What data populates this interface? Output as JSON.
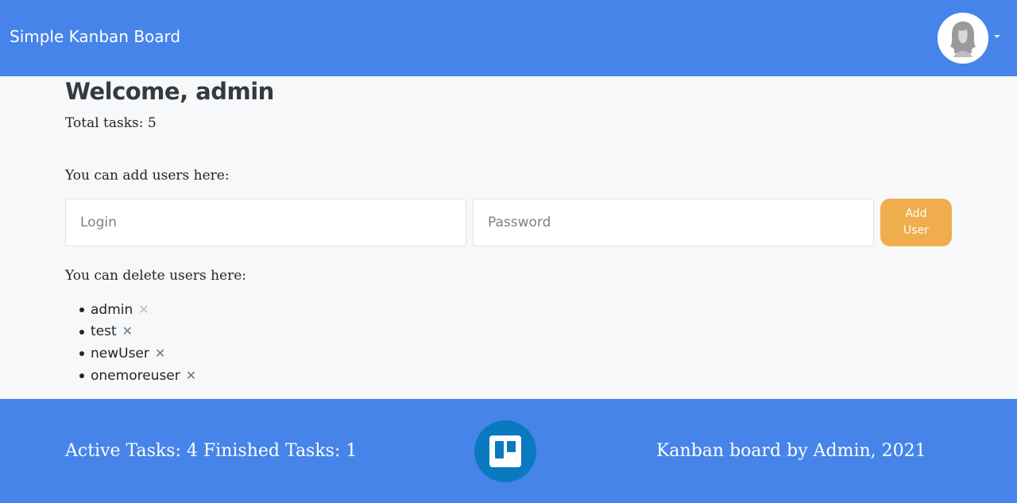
{
  "header": {
    "brand": "Simple Kanban Board",
    "avatar_icon": "user-avatar-icon",
    "menu_icon": "caret-down-icon",
    "color": "#4684ea"
  },
  "main": {
    "welcome": "Welcome, admin",
    "total_tasks": "Total tasks: 5",
    "add_users_label": "You can add users here:",
    "login_placeholder": "Login",
    "password_placeholder": "Password",
    "add_user_button": "Add User",
    "add_user_button_color": "#f0ad4e",
    "delete_users_label": "You can delete users here:",
    "users": [
      {
        "name": "admin",
        "delete_icon": "close-icon",
        "delete_enabled": false
      },
      {
        "name": "test",
        "delete_icon": "close-icon",
        "delete_enabled": true
      },
      {
        "name": "newUser",
        "delete_icon": "close-icon",
        "delete_enabled": true
      },
      {
        "name": "onemoreuser",
        "delete_icon": "close-icon",
        "delete_enabled": true
      }
    ]
  },
  "footer": {
    "stats": "Active Tasks: 4 Finished Tasks: 1",
    "logo_icon": "trello-icon",
    "credit": "Kanban board by Admin, 2021",
    "color": "#4684ea"
  }
}
